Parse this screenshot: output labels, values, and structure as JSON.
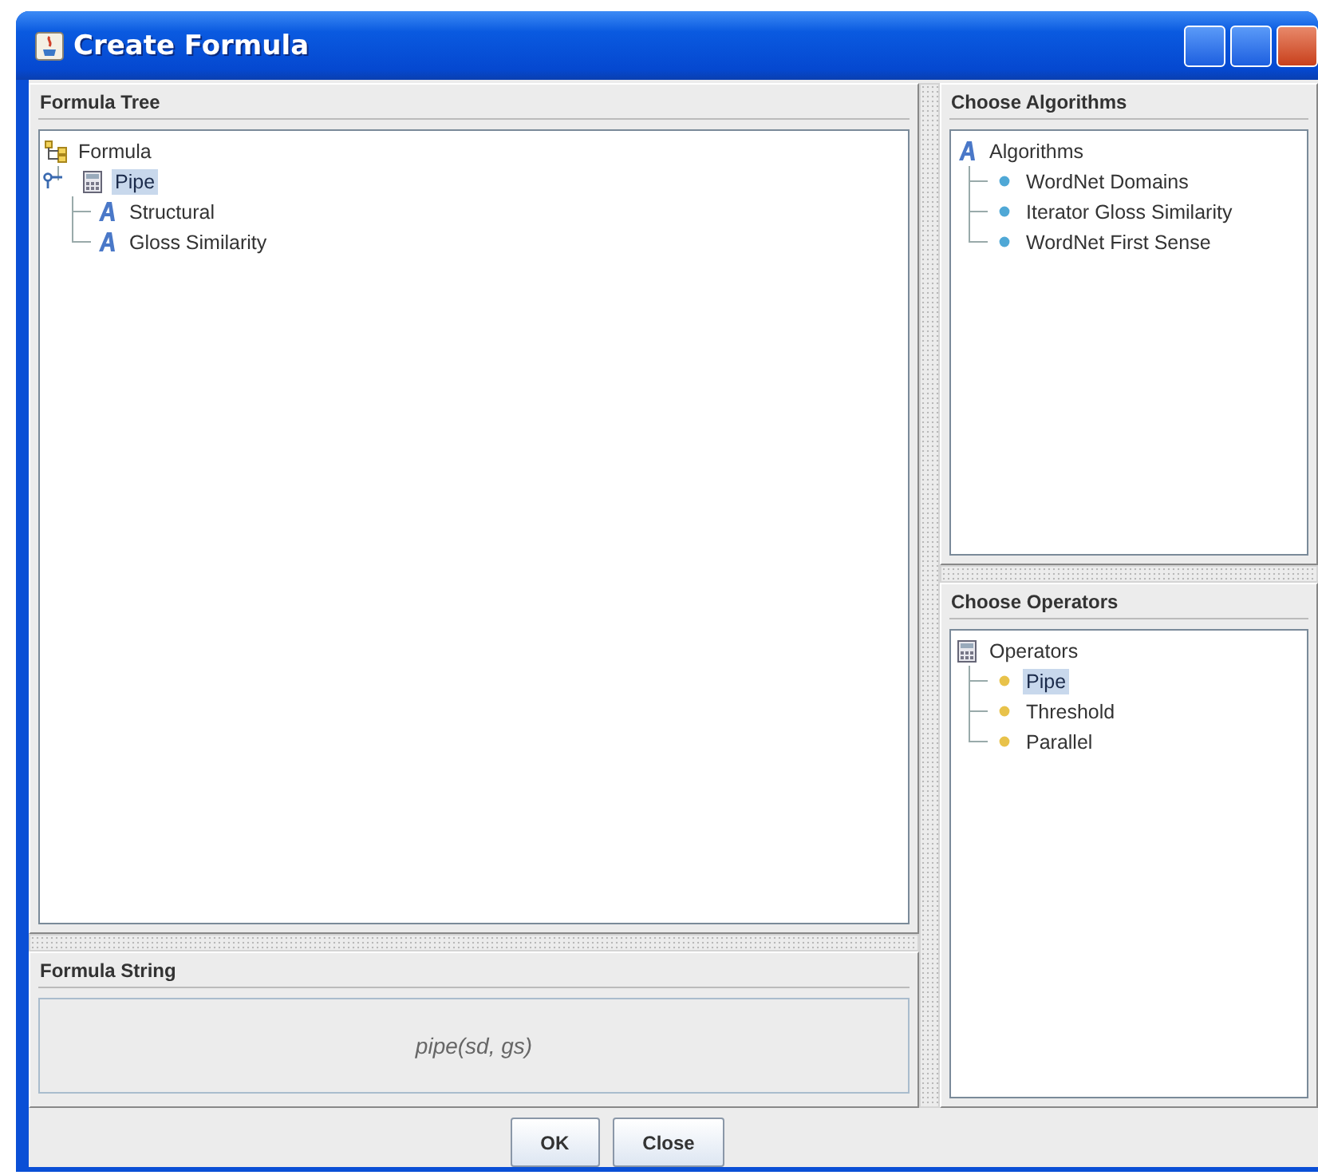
{
  "window": {
    "title": "Create Formula"
  },
  "formula_tree": {
    "title": "Formula Tree",
    "nodes": [
      {
        "label": "Formula",
        "kind": "folders",
        "selected": false,
        "children": [
          {
            "label": "Pipe",
            "kind": "calculator",
            "selected": true,
            "children": [
              {
                "label": "Structural",
                "kind": "glyph",
                "selected": false
              },
              {
                "label": "Gloss Similarity",
                "kind": "glyph",
                "selected": false
              }
            ]
          }
        ]
      }
    ]
  },
  "formula_string": {
    "title": "Formula String",
    "value": "pipe(sd, gs)"
  },
  "algorithms": {
    "title": "Choose Algorithms",
    "nodes": [
      {
        "label": "Algorithms",
        "kind": "glyph",
        "selected": false,
        "children": [
          {
            "label": "WordNet Domains",
            "kind": "algorithm",
            "selected": false
          },
          {
            "label": "Iterator Gloss Similarity",
            "kind": "algorithm",
            "selected": false
          },
          {
            "label": "WordNet First Sense",
            "kind": "algorithm",
            "selected": false
          }
        ]
      }
    ]
  },
  "operators": {
    "title": "Choose Operators",
    "nodes": [
      {
        "label": "Operators",
        "kind": "calculator",
        "selected": false,
        "children": [
          {
            "label": "Pipe",
            "kind": "operator",
            "selected": true
          },
          {
            "label": "Threshold",
            "kind": "operator",
            "selected": false
          },
          {
            "label": "Parallel",
            "kind": "operator",
            "selected": false
          }
        ]
      }
    ]
  },
  "buttons": [
    "OK",
    "Close"
  ]
}
